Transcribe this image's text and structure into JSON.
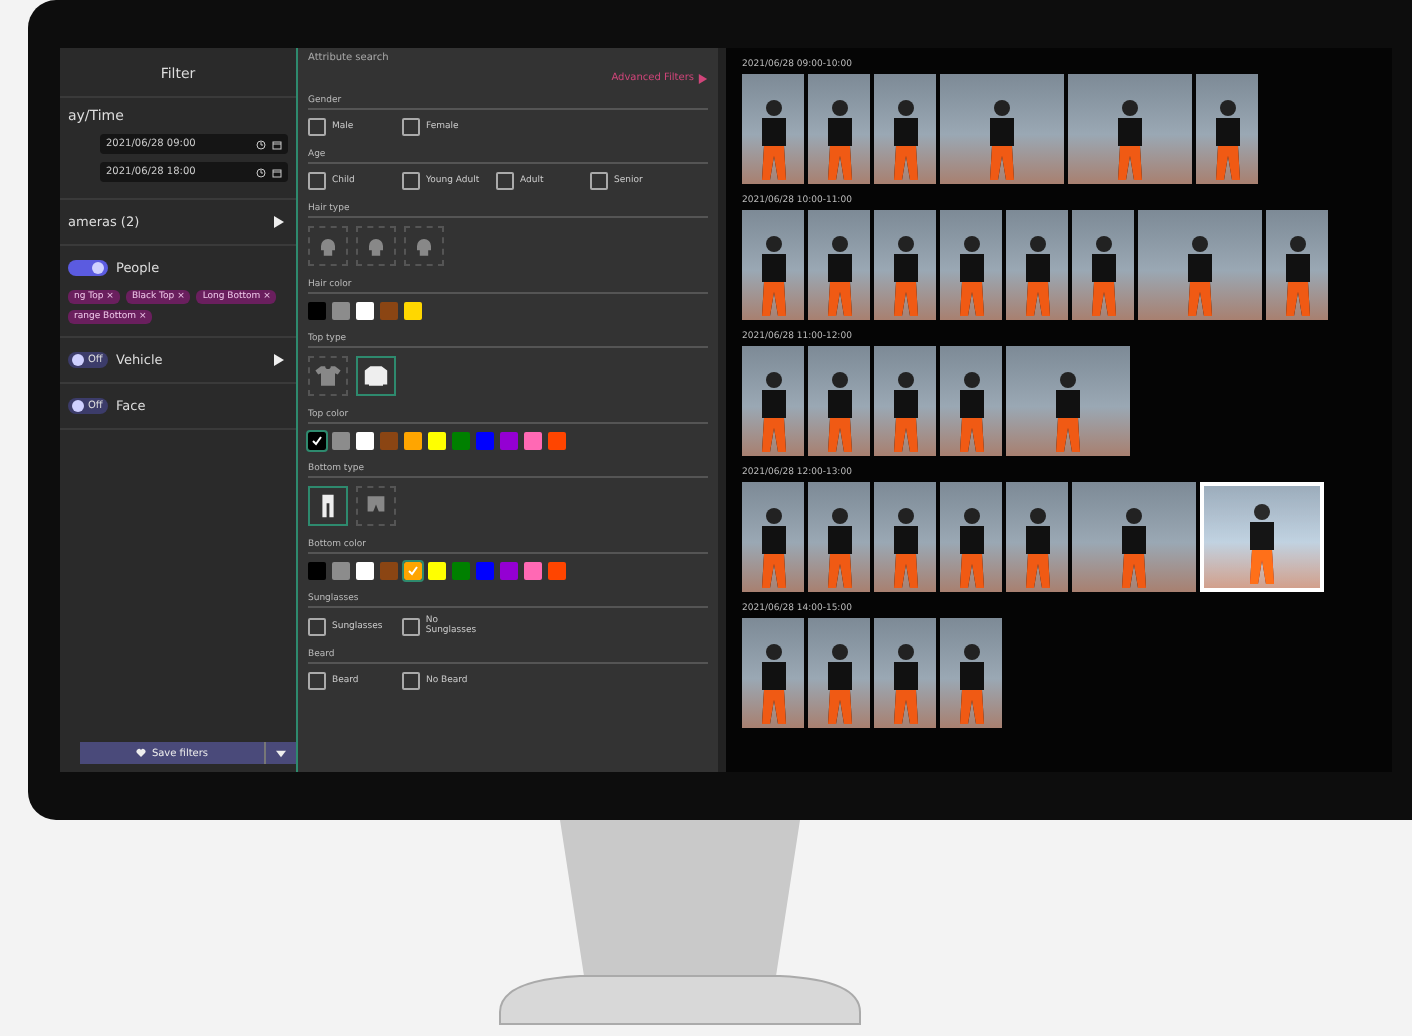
{
  "filter_panel": {
    "title": "Filter",
    "date_section": {
      "label": "ay/Time",
      "fields": [
        {
          "value": "2021/06/28 09:00"
        },
        {
          "value": "2021/06/28 18:00"
        }
      ]
    },
    "cameras": {
      "label": "ameras (2)"
    },
    "categories": [
      {
        "label": "People",
        "on": true,
        "chips": [
          "ng Top ×",
          "Black Top ×",
          "Long Bottom ×",
          "range Bottom ×"
        ],
        "expandable": false
      },
      {
        "label": "Vehicle",
        "on": false,
        "toggle_text": "Off",
        "expandable": true
      },
      {
        "label": "Face",
        "on": false,
        "toggle_text": "Off",
        "expandable": false
      }
    ],
    "save_button": "Save filters"
  },
  "attribute_panel": {
    "title": "Attribute search",
    "advanced_link": "Advanced Filters",
    "sections": [
      {
        "kind": "checks",
        "title": "Gender",
        "options": [
          {
            "label": "Male",
            "checked": false
          },
          {
            "label": "Female",
            "checked": false
          }
        ]
      },
      {
        "kind": "checks",
        "title": "Age",
        "options": [
          {
            "label": "Child",
            "checked": false
          },
          {
            "label": "Young Adult",
            "checked": false
          },
          {
            "label": "Adult",
            "checked": false
          },
          {
            "label": "Senior",
            "checked": false
          }
        ]
      },
      {
        "kind": "types",
        "title": "Hair type",
        "types": [
          {
            "kind": "head",
            "selected": false
          },
          {
            "kind": "head",
            "selected": false
          },
          {
            "kind": "head",
            "selected": false
          }
        ]
      },
      {
        "kind": "colors",
        "title": "Hair color",
        "swatches": [
          {
            "color": "#000000",
            "checked": false
          },
          {
            "color": "#8c8c8c",
            "checked": false
          },
          {
            "color": "#ffffff",
            "checked": false
          },
          {
            "color": "#8b4513",
            "checked": false
          },
          {
            "color": "#ffd700",
            "checked": false
          }
        ]
      },
      {
        "kind": "types",
        "title": "Top type",
        "types": [
          {
            "kind": "tshirt",
            "selected": false
          },
          {
            "kind": "longsleeve",
            "selected": true
          }
        ]
      },
      {
        "kind": "colors",
        "title": "Top color",
        "swatches": [
          {
            "color": "#000000",
            "checked": true
          },
          {
            "color": "#8c8c8c",
            "checked": false
          },
          {
            "color": "#ffffff",
            "checked": false
          },
          {
            "color": "#8b4513",
            "checked": false
          },
          {
            "color": "#ffa500",
            "checked": false
          },
          {
            "color": "#ffff00",
            "checked": false
          },
          {
            "color": "#008000",
            "checked": false
          },
          {
            "color": "#0000ff",
            "checked": false
          },
          {
            "color": "#9400d3",
            "checked": false
          },
          {
            "color": "#ff69b4",
            "checked": false
          },
          {
            "color": "#ff4500",
            "checked": false
          }
        ]
      },
      {
        "kind": "types",
        "title": "Bottom type",
        "types": [
          {
            "kind": "pants",
            "selected": true
          },
          {
            "kind": "shorts",
            "selected": false
          }
        ]
      },
      {
        "kind": "colors",
        "title": "Bottom color",
        "swatches": [
          {
            "color": "#000000",
            "checked": false
          },
          {
            "color": "#8c8c8c",
            "checked": false
          },
          {
            "color": "#ffffff",
            "checked": false
          },
          {
            "color": "#8b4513",
            "checked": false
          },
          {
            "color": "#ffa500",
            "checked": true
          },
          {
            "color": "#ffff00",
            "checked": false
          },
          {
            "color": "#008000",
            "checked": false
          },
          {
            "color": "#0000ff",
            "checked": false
          },
          {
            "color": "#9400d3",
            "checked": false
          },
          {
            "color": "#ff69b4",
            "checked": false
          },
          {
            "color": "#ff4500",
            "checked": false
          }
        ]
      },
      {
        "kind": "checks",
        "title": "Sunglasses",
        "options": [
          {
            "label": "Sunglasses",
            "checked": false
          },
          {
            "label": "No Sunglasses",
            "checked": false
          }
        ]
      },
      {
        "kind": "checks",
        "title": "Beard",
        "options": [
          {
            "label": "Beard",
            "checked": false
          },
          {
            "label": "No Beard",
            "checked": false
          }
        ]
      }
    ]
  },
  "results": [
    {
      "time": "2021/06/28 09:00-10:00",
      "thumbnails": [
        {
          "kind": "narrow",
          "selected": false
        },
        {
          "kind": "narrow",
          "selected": false
        },
        {
          "kind": "narrow",
          "selected": false
        },
        {
          "kind": "wide",
          "selected": false
        },
        {
          "kind": "wide",
          "selected": false
        },
        {
          "kind": "narrow",
          "selected": false
        }
      ]
    },
    {
      "time": "2021/06/28 10:00-11:00",
      "thumbnails": [
        {
          "kind": "narrow",
          "selected": false
        },
        {
          "kind": "narrow",
          "selected": false
        },
        {
          "kind": "narrow",
          "selected": false
        },
        {
          "kind": "narrow",
          "selected": false
        },
        {
          "kind": "narrow",
          "selected": false
        },
        {
          "kind": "narrow",
          "selected": false
        },
        {
          "kind": "wide",
          "selected": false
        },
        {
          "kind": "narrow",
          "selected": false
        }
      ]
    },
    {
      "time": "2021/06/28 11:00-12:00",
      "thumbnails": [
        {
          "kind": "narrow",
          "selected": false
        },
        {
          "kind": "narrow",
          "selected": false
        },
        {
          "kind": "narrow",
          "selected": false
        },
        {
          "kind": "narrow",
          "selected": false
        },
        {
          "kind": "wide",
          "selected": false
        }
      ]
    },
    {
      "time": "2021/06/28 12:00-13:00",
      "thumbnails": [
        {
          "kind": "narrow",
          "selected": false
        },
        {
          "kind": "narrow",
          "selected": false
        },
        {
          "kind": "narrow",
          "selected": false
        },
        {
          "kind": "narrow",
          "selected": false
        },
        {
          "kind": "narrow",
          "selected": false
        },
        {
          "kind": "wide",
          "selected": false
        },
        {
          "kind": "wide",
          "selected": true
        }
      ]
    },
    {
      "time": "2021/06/28 14:00-15:00",
      "thumbnails": [
        {
          "kind": "narrow",
          "selected": false
        },
        {
          "kind": "narrow",
          "selected": false
        },
        {
          "kind": "narrow",
          "selected": false
        },
        {
          "kind": "narrow",
          "selected": false
        }
      ]
    }
  ]
}
